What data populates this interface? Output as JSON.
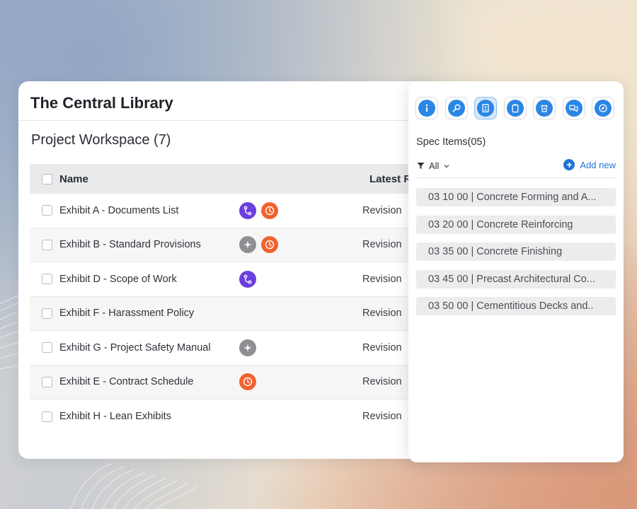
{
  "app": {
    "title": "The Central Library"
  },
  "workspace": {
    "title": "Project Workspace (7)"
  },
  "table": {
    "headers": {
      "name": "Name",
      "latest": "Latest R"
    },
    "rows": [
      {
        "name": "Exhibit A - Documents List",
        "icons": [
          "branch-icon",
          "history-icon"
        ],
        "revision": "Revision"
      },
      {
        "name": "Exhibit B - Standard Provisions",
        "icons": [
          "sparkle-icon",
          "history-icon"
        ],
        "revision": "Revision"
      },
      {
        "name": "Exhibit D - Scope of Work",
        "icons": [
          "branch-icon"
        ],
        "revision": "Revision"
      },
      {
        "name": "Exhibit F - Harassment Policy",
        "icons": [],
        "revision": "Revision"
      },
      {
        "name": "Exhibit G - Project Safety Manual",
        "icons": [
          "sparkle-icon"
        ],
        "revision": "Revision"
      },
      {
        "name": "Exhibit E - Contract Schedule",
        "icons": [
          "history-icon"
        ],
        "revision": "Revision"
      },
      {
        "name": "Exhibit H - Lean Exhibits",
        "icons": [],
        "revision": "Revision"
      }
    ]
  },
  "panel": {
    "toolbar": [
      "info-icon",
      "search-icon",
      "id-card-icon",
      "clipboard-icon",
      "recycle-icon",
      "chat-icon",
      "compass-icon"
    ],
    "active_tool": "id-card-icon",
    "spec_title": "Spec Items(05)",
    "filter_label": "All",
    "add_new_label": "Add new",
    "spec_items": [
      "03 10 00 | Concrete Forming and A...",
      "03 20 00 | Concrete Reinforcing",
      "03 35 00 | Concrete Finishing",
      "03 45 00 | Precast Architectural Co...",
      "03 50 00 | Cementitious Decks and.."
    ]
  },
  "colors": {
    "accent": "#2b86e6",
    "link": "#1f73d1",
    "badge_purple": "#6c3fe0",
    "badge_orange": "#f2622e",
    "badge_gray": "#8d8f93"
  }
}
